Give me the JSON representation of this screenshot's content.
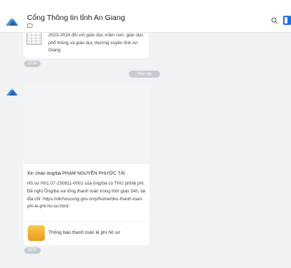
{
  "header": {
    "title": "Cổng Thông tin tỉnh An Giang",
    "search_icon": "search-icon",
    "panel_icon": "side-panel-icon",
    "accent": "#1a73e8"
  },
  "messages": {
    "prev_card_text": "2023-2024 đối với giáo dục mầm non, giáo dục phổ thông và giáo dục thường xuyên tỉnh An Giang",
    "prev_time": "13:38",
    "date_separator": "Hôm nay",
    "greeting": "Xin chào ông/bà PHẠM NGUYỄN PHƯỚC TÀI",
    "body_line1": "Hồ sơ H01.07-230811-0001 của ông/bà có THU phí/lệ phí. Đề nghị Ông/bà vui lòng thanh toán trong thời gian 24h, tại địa chỉ:",
    "body_link": "https://dichvucong.gov.vn/p/home/dvc-thanh-toan-phi-le-phi-ho-so.html",
    "attachment_label": "Thông báo thanh toán lệ phí hồ sơ",
    "time": "09:37"
  }
}
